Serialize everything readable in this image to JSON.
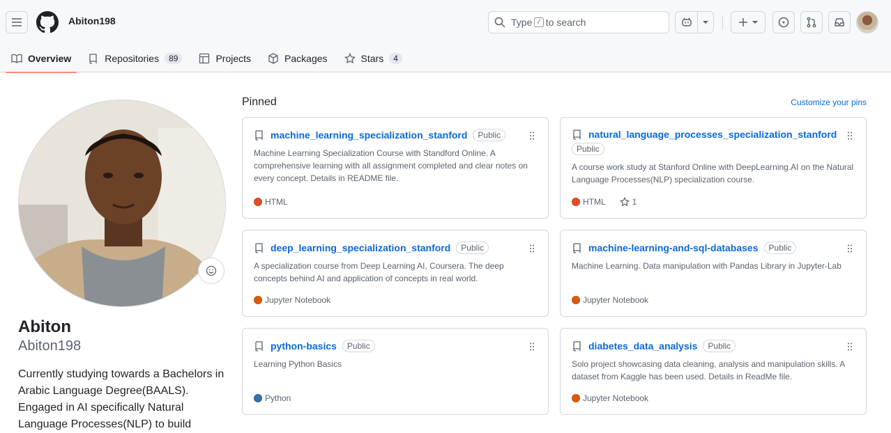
{
  "header": {
    "username": "Abiton198",
    "search": {
      "prefix": "Type",
      "key": "/",
      "suffix": "to search"
    }
  },
  "tabs": [
    {
      "label": "Overview",
      "icon": "book-icon"
    },
    {
      "label": "Repositories",
      "icon": "repo-icon",
      "count": "89"
    },
    {
      "label": "Projects",
      "icon": "table-icon"
    },
    {
      "label": "Packages",
      "icon": "package-icon"
    },
    {
      "label": "Stars",
      "icon": "star-icon",
      "count": "4"
    }
  ],
  "profile": {
    "name": "Abiton",
    "login": "Abiton198",
    "bio": "Currently studying towards a Bachelors in Arabic Language Degree(BAALS). Engaged in AI specifically Natural Language Processes(NLP) to build"
  },
  "pinned": {
    "title": "Pinned",
    "customize": "Customize your pins",
    "repos": [
      {
        "name": "machine_learning_specialization_stanford",
        "visibility": "Public",
        "description": "Machine Learning Specialization Course with Standford Online. A comprehensive learning with all assignment completed and clear notes on every concept. Details in README file.",
        "language": "HTML",
        "lang_color": "#e34c26",
        "stars": ""
      },
      {
        "name": "natural_language_processes_specialization_stanford",
        "visibility": "Public",
        "description": "A course work study at Stanford Online with DeepLearning.AI on the Natural Language Processes(NLP) specialization course.",
        "language": "HTML",
        "lang_color": "#e34c26",
        "stars": "1"
      },
      {
        "name": "deep_learning_specialization_stanford",
        "visibility": "Public",
        "description": "A specialization course from Deep Learning AI, Coursera. The deep concepts behind AI and application of concepts in real world.",
        "language": "Jupyter Notebook",
        "lang_color": "#da5b0b",
        "stars": ""
      },
      {
        "name": "machine-learning-and-sql-databases",
        "visibility": "Public",
        "description": "Machine Learning. Data manipulation with Pandas Library in Jupyter-Lab",
        "language": "Jupyter Notebook",
        "lang_color": "#da5b0b",
        "stars": ""
      },
      {
        "name": "python-basics",
        "visibility": "Public",
        "description": "Learning Python Basics",
        "language": "Python",
        "lang_color": "#3572A5",
        "stars": ""
      },
      {
        "name": "diabetes_data_analysis",
        "visibility": "Public",
        "description": "Solo project showcasing data cleaning, analysis and manipulation skills. A dataset from Kaggle has been used. Details in ReadMe file.",
        "language": "Jupyter Notebook",
        "lang_color": "#da5b0b",
        "stars": ""
      }
    ]
  }
}
